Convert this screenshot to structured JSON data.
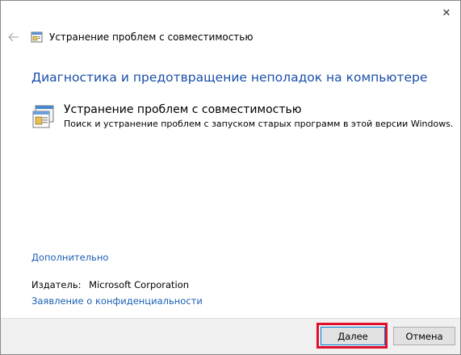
{
  "window": {
    "title": "Устранение проблем с совместимостью",
    "close_label": "✕"
  },
  "main": {
    "heading": "Диагностика и предотвращение неполадок на компьютере",
    "troubleshooter": {
      "title": "Устранение проблем с совместимостью",
      "description": "Поиск и устранение проблем с запуском старых программ в этой версии Windows.",
      "icon": "compatibility-troubleshooter-icon"
    }
  },
  "links": {
    "advanced": "Дополнительно",
    "privacy": "Заявление о конфиденциальности"
  },
  "publisher": {
    "label": "Издатель:",
    "value": "Microsoft Corporation"
  },
  "footer": {
    "next_label": "Далее",
    "cancel_label": "Отмена"
  },
  "colors": {
    "heading": "#1a4ea8",
    "link": "#1a5fb4",
    "highlight": "#e0102a",
    "footer_bg": "#f0f0f0"
  }
}
